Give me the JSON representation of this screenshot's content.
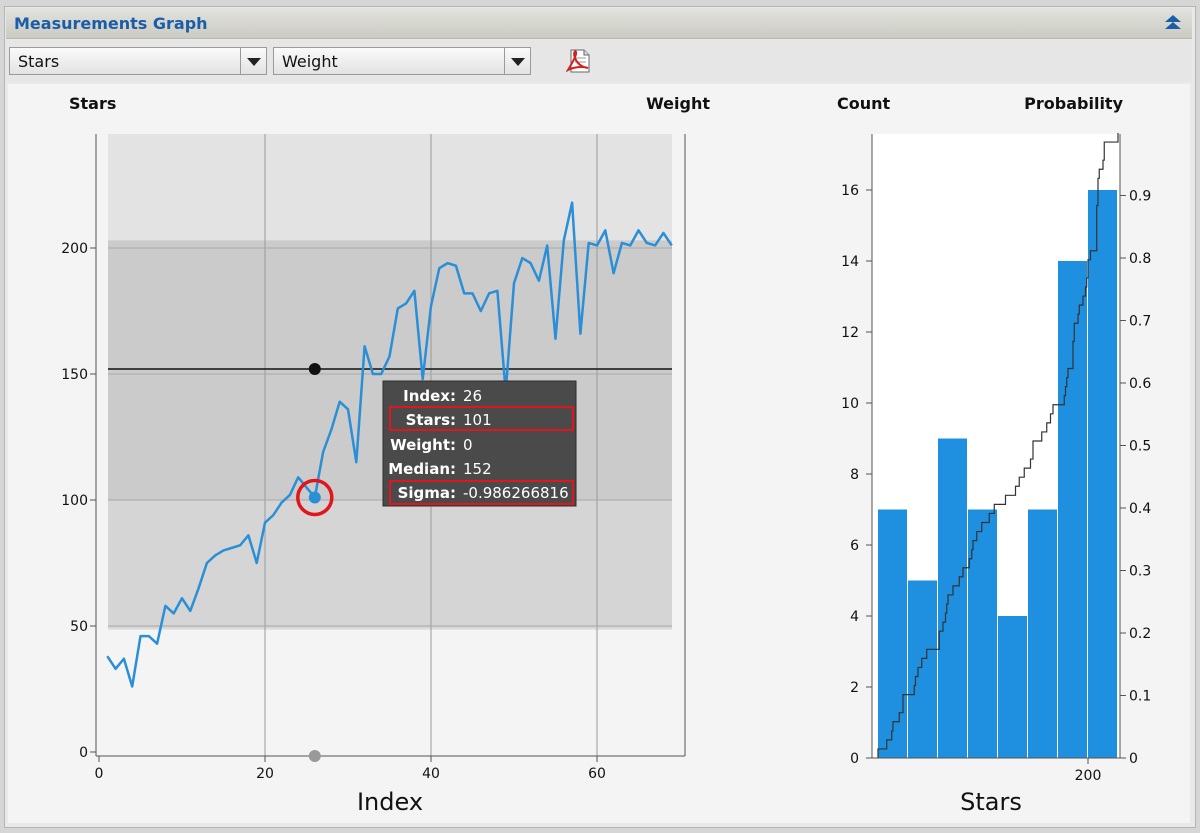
{
  "window": {
    "title": "Measurements Graph"
  },
  "toolbar": {
    "y_select": {
      "value": "Stars"
    },
    "weight_select": {
      "value": "Weight"
    },
    "export_icon": "pdf-export-icon"
  },
  "line_chart": {
    "left_label": "Stars",
    "right_label": "Weight",
    "xlabel": "Index",
    "x_ticks": [
      "0",
      "20",
      "40",
      "60"
    ],
    "y_ticks": [
      "0",
      "50",
      "100",
      "150",
      "200"
    ],
    "median": 152
  },
  "tooltip": {
    "index_label": "Index:",
    "index_value": "26",
    "stars_label": "Stars:",
    "stars_value": "101",
    "weight_label": "Weight:",
    "weight_value": "0",
    "median_label": "Median:",
    "median_value": "152",
    "sigma_label": "Sigma:",
    "sigma_value": "-0.986266816"
  },
  "histogram": {
    "left_label": "Count",
    "right_label": "Probability",
    "xlabel": "Stars",
    "x_ticks": [
      "200"
    ],
    "y_ticks": [
      "0",
      "2",
      "4",
      "6",
      "8",
      "10",
      "12",
      "14",
      "16"
    ],
    "p_ticks": [
      "0",
      "0.1",
      "0.2",
      "0.3",
      "0.4",
      "0.5",
      "0.6",
      "0.7",
      "0.8",
      "0.9"
    ]
  },
  "colors": {
    "series": "#2a8fd6",
    "bar": "#1f8fe0",
    "accent": "#1a5ea8",
    "highlight": "#e0161c"
  },
  "chart_data": [
    {
      "type": "line",
      "xlabel": "Index",
      "ylabel": "",
      "xlim": [
        0,
        70
      ],
      "ylim": [
        0,
        240
      ],
      "median": 152,
      "series": [
        {
          "x": [
            1,
            2,
            3,
            4,
            5,
            6,
            7,
            8,
            9,
            10,
            11,
            12,
            13,
            14,
            15,
            16,
            17,
            18,
            19,
            20,
            21,
            22,
            23,
            24,
            25,
            26,
            27,
            28,
            29,
            30,
            31,
            32,
            33,
            34,
            35,
            36,
            37,
            38,
            39,
            40,
            41,
            42,
            43,
            44,
            45,
            46,
            47,
            48,
            49,
            50,
            51,
            52,
            53,
            54,
            55,
            56,
            57,
            58,
            59,
            60,
            61,
            62,
            63,
            64,
            65,
            66,
            67,
            68,
            69
          ],
          "y": [
            38,
            33,
            37,
            26,
            46,
            46,
            43,
            58,
            55,
            61,
            56,
            65,
            75,
            78,
            80,
            81,
            82,
            86,
            75,
            91,
            94,
            99,
            102,
            109,
            105,
            101,
            119,
            128,
            139,
            136,
            115,
            161,
            150,
            150,
            157,
            176,
            178,
            183,
            148,
            177,
            192,
            194,
            193,
            182,
            182,
            175,
            182,
            183,
            143,
            186,
            196,
            194,
            187,
            201,
            164,
            203,
            218,
            166,
            202,
            201,
            207,
            190,
            202,
            201,
            207,
            202,
            201,
            206,
            201
          ]
        }
      ],
      "highlight": {
        "index": 26,
        "stars": 101
      }
    },
    {
      "type": "bar",
      "xlabel": "Stars",
      "ylabel": "Count",
      "ylim": [
        0,
        17.5
      ],
      "bars": [
        7,
        5,
        9,
        7,
        4,
        7,
        14,
        16
      ],
      "cumulative_probability": "step line from 0 to 1.0 across the histogram",
      "x_tick": {
        "value": 200,
        "label": "200"
      }
    }
  ]
}
